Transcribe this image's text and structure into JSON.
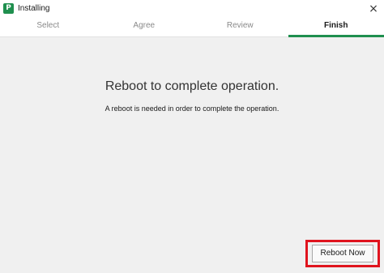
{
  "window": {
    "title": "Installing",
    "app_icon_letter": "P",
    "close_glyph": "×"
  },
  "tabs": [
    {
      "label": "Select",
      "active": false
    },
    {
      "label": "Agree",
      "active": false
    },
    {
      "label": "Review",
      "active": false
    },
    {
      "label": "Finish",
      "active": true
    }
  ],
  "content": {
    "heading": "Reboot to complete operation.",
    "message": "A reboot is needed in order to complete the operation."
  },
  "actions": {
    "reboot_label": "Reboot Now"
  },
  "colors": {
    "accent": "#1f8f4e",
    "highlight": "#e0141e",
    "background": "#f0f0f0"
  },
  "icons": {
    "app": "app-logo-icon",
    "close": "close-icon"
  }
}
